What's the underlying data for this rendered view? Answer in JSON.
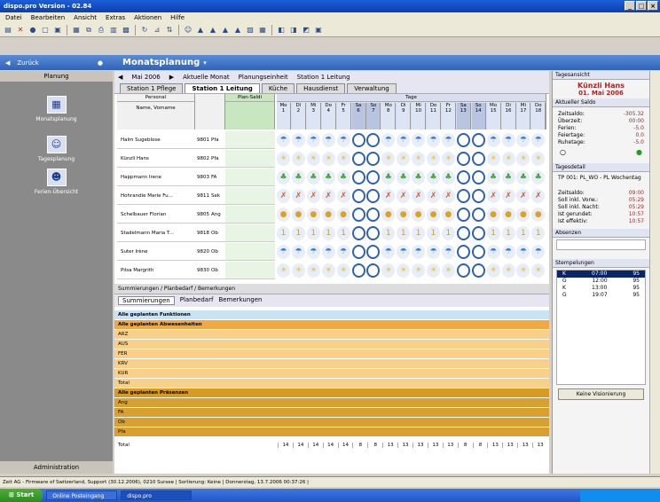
{
  "window": {
    "title": "dispo.pro Version - 02.84"
  },
  "menu": [
    "Datei",
    "Bearbeiten",
    "Ansicht",
    "Extras",
    "Aktionen",
    "Hilfe"
  ],
  "nav": {
    "back_label": "Zurück",
    "section_title": "Monatsplanung",
    "planning_label": "Planung",
    "admin_label": "Administration"
  },
  "sidebar_items": [
    {
      "label": "Monatsplanung",
      "icon": "calendar-icon"
    },
    {
      "label": "Tagesplanung",
      "icon": "people-icon"
    },
    {
      "label": "Ferien-Übersicht",
      "icon": "group-icon"
    }
  ],
  "subheader": {
    "month_label": "Mai 2006",
    "current_month": "Aktuelle Monat",
    "unit_label": "Planungseinheit",
    "unit_value": "Station 1 Leitung"
  },
  "tabs": [
    "Station 1 Pflege",
    "Station 1 Leitung",
    "Küche",
    "Hausdienst",
    "Verwaltung"
  ],
  "grid": {
    "personal_header": "Personal",
    "plan_header": "Plan-Saldi",
    "days_header": "Tage",
    "name_col": "Name, Vorname",
    "day_names": [
      "Mo",
      "Di",
      "Mi",
      "Do",
      "Fr",
      "Sa",
      "So",
      "Mo",
      "Di",
      "Mi",
      "Do",
      "Fr",
      "Sa",
      "So",
      "Mo",
      "Di",
      "Mi",
      "Do"
    ],
    "day_numbers": [
      "1",
      "2",
      "3",
      "4",
      "5",
      "6",
      "7",
      "8",
      "9",
      "10",
      "11",
      "12",
      "13",
      "14",
      "15",
      "16",
      "17",
      "18"
    ],
    "rows": [
      {
        "name": "Halm Sugeblose",
        "code": "9801",
        "role": "Pfa"
      },
      {
        "name": "Künzli Hans",
        "code": "9802",
        "role": "Pfa"
      },
      {
        "name": "Happmann Irene",
        "code": "9803",
        "role": "FA"
      },
      {
        "name": "Hohrandie Marie Fu...",
        "code": "9811",
        "role": "Sek"
      },
      {
        "name": "Schelbauer Florian",
        "code": "9805",
        "role": "Ang"
      },
      {
        "name": "Stadelmann Maria T...",
        "code": "9818",
        "role": "Ob"
      },
      {
        "name": "Suter Irène",
        "code": "9820",
        "role": "Ob"
      },
      {
        "name": "Pilsa Margrith",
        "code": "9830",
        "role": "Ob"
      }
    ]
  },
  "summary": {
    "outer_tabs": "Summierungen / Planbedarf / Bemerkungen",
    "tabs": [
      "Summierungen",
      "Planbedarf",
      "Bemerkungen"
    ],
    "group1": "Alle geplanten Funktionen",
    "group2": "Alle geplanten Abwesenheiten",
    "absence_rows": [
      "ARZ",
      "AUS",
      "FER",
      "KRV",
      "KUR",
      "Total"
    ],
    "group3": "Alle geplanten Präsenzen",
    "presence_rows": [
      "Ang",
      "FA",
      "Ob",
      "Pfa"
    ],
    "total_label": "Total",
    "totals": [
      "14",
      "14",
      "14",
      "14",
      "14",
      "8",
      "8",
      "13",
      "13",
      "13",
      "13",
      "13",
      "8",
      "8",
      "13",
      "13",
      "13",
      "13"
    ]
  },
  "right_panel": {
    "section": "Tagesansicht",
    "person": "Künzli Hans",
    "date": "01. Mai 2006",
    "saldi_header": "Aktueller Saldo",
    "saldi": [
      {
        "label": "Zeitsaldo:",
        "value": "-305.32"
      },
      {
        "label": "Überzeit:",
        "value": "00:00"
      },
      {
        "label": "Ferien:",
        "value": "-5.0"
      },
      {
        "label": "Feiertage:",
        "value": "0.0"
      },
      {
        "label": "Ruhetage:",
        "value": "-5.0"
      }
    ],
    "day_header": "Tagesdetail",
    "shift": "TP 001: PL_WO - PL Wochentag",
    "day_values": [
      {
        "label": "Zeitsaldo:",
        "value": "09:00"
      },
      {
        "label": "Soll inkl. Vorw.:",
        "value": "05:29"
      },
      {
        "label": "Soll inkl. Nacht:",
        "value": "05:29"
      },
      {
        "label": "Ist gerundet:",
        "value": "10:57"
      },
      {
        "label": "Ist effektiv:",
        "value": "10:57"
      }
    ],
    "absences_header": "Absenzen",
    "stamps_header": "Stempelungen",
    "stamps": [
      {
        "kind": "K",
        "time": "07:00",
        "code": "95"
      },
      {
        "kind": "G",
        "time": "12:00",
        "code": "95"
      },
      {
        "kind": "K",
        "time": "13:00",
        "code": "95"
      },
      {
        "kind": "G",
        "time": "19:07",
        "code": "95"
      }
    ],
    "vision_button": "Keine Visionierung"
  },
  "statusbar": "Zeit AG - Firmware of Switzerland, Support (30.12.2006), 0210 Sursee | Sortierung: Keine | Donnerstag, 13.7.2006 00:37:26 |",
  "taskbar": {
    "start": "Start",
    "task1": "Online Posteingang",
    "task2": "dispo.pro"
  },
  "icons": {
    "start": "windows-logo-icon",
    "alarm": "clock-icon"
  }
}
